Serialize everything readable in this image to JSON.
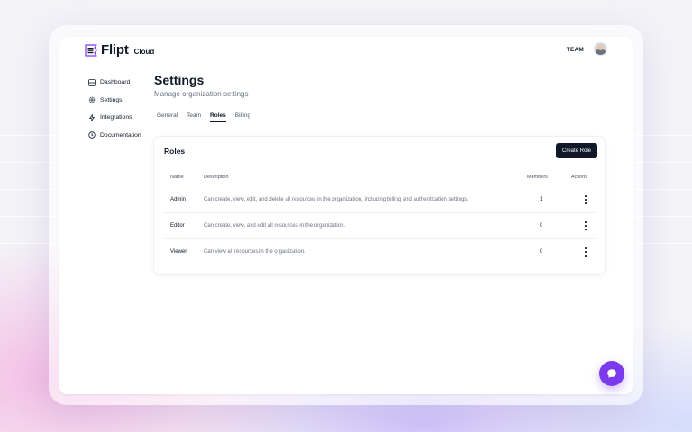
{
  "brand": {
    "name": "Flipt",
    "suffix": "Cloud",
    "accent": "#7c3aed"
  },
  "header": {
    "team_label": "TEAM"
  },
  "sidebar": {
    "items": [
      {
        "label": "Dashboard",
        "icon": "dashboard-icon"
      },
      {
        "label": "Settings",
        "icon": "gear-icon"
      },
      {
        "label": "Integrations",
        "icon": "bolt-icon"
      },
      {
        "label": "Documentation",
        "icon": "help-circle-icon"
      }
    ]
  },
  "page": {
    "title": "Settings",
    "subtitle": "Manage organization settings"
  },
  "tabs": [
    {
      "label": "General",
      "active": false
    },
    {
      "label": "Team",
      "active": false
    },
    {
      "label": "Roles",
      "active": true
    },
    {
      "label": "Billing",
      "active": false
    }
  ],
  "roles": {
    "title": "Roles",
    "create_label": "Create Role",
    "columns": {
      "name": "Name",
      "description": "Description",
      "members": "Members",
      "actions": "Actions"
    },
    "rows": [
      {
        "name": "Admin",
        "description": "Can create, view, edit, and delete all resources in the organization, including billing and authentication settings.",
        "members": "1"
      },
      {
        "name": "Editor",
        "description": "Can create, view, and edit all resources in the organization.",
        "members": "0"
      },
      {
        "name": "Viewer",
        "description": "Can view all resources in the organization.",
        "members": "0"
      }
    ]
  },
  "chat": {
    "icon": "chat-bubble-icon"
  }
}
